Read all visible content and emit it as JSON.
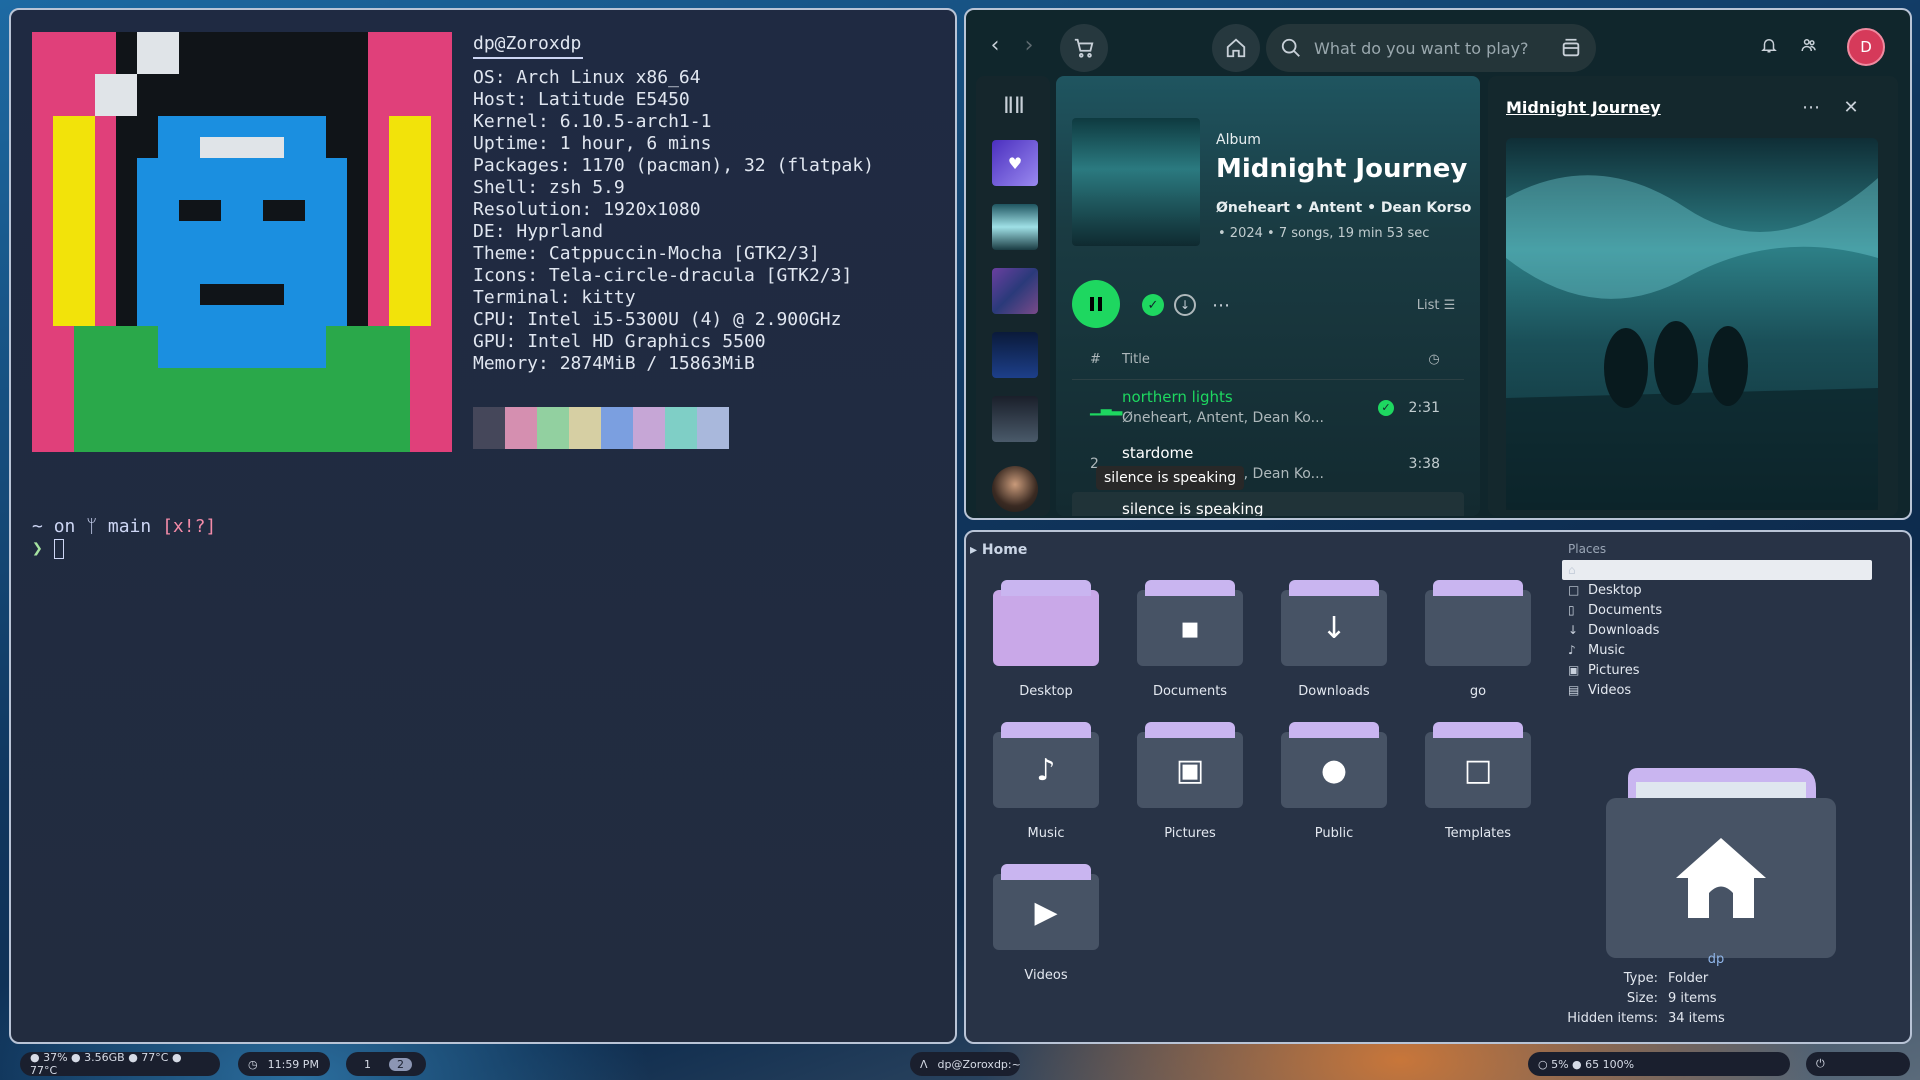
{
  "terminal": {
    "user_host": "dp@Zoroxdp",
    "info": [
      {
        "key": "OS",
        "value": "Arch Linux x86_64"
      },
      {
        "key": "Host",
        "value": "Latitude E5450"
      },
      {
        "key": "Kernel",
        "value": "6.10.5-arch1-1"
      },
      {
        "key": "Uptime",
        "value": "1 hour, 6 mins"
      },
      {
        "key": "Packages",
        "value": "1170 (pacman), 32 (flatpak)"
      },
      {
        "key": "Shell",
        "value": "zsh 5.9"
      },
      {
        "key": "Resolution",
        "value": "1920x1080"
      },
      {
        "key": "DE",
        "value": "Hyprland"
      },
      {
        "key": "Theme",
        "value": "Catppuccin-Mocha [GTK2/3]"
      },
      {
        "key": "Icons",
        "value": "Tela-circle-dracula [GTK2/3]"
      },
      {
        "key": "Terminal",
        "value": "kitty"
      },
      {
        "key": "CPU",
        "value": "Intel i5-5300U (4) @ 2.900GHz"
      },
      {
        "key": "GPU",
        "value": "Intel HD Graphics 5500"
      },
      {
        "key": "Memory",
        "value": "2874MiB / 15863MiB"
      }
    ],
    "swatch_colors": [
      "#45475a",
      "#d58fb0",
      "#92d0a0",
      "#d6cfa3",
      "#7b9fe0",
      "#c6a6d6",
      "#7fcfc6",
      "#a9b8dc"
    ],
    "prompt": {
      "dir": "~",
      "on": "on",
      "branch_icon": "ᛘ",
      "branch": "main",
      "flags": "[x!?]",
      "arrow": "❯"
    }
  },
  "spotify": {
    "search_placeholder": "What do you want to play?",
    "avatar_letter": "D",
    "album": {
      "type": "Album",
      "title": "Midnight Journey",
      "artists": "Øneheart • Antent • Dean Korso",
      "meta": "• 2024 • 7 songs, 19 min 53 sec"
    },
    "list_label": "List",
    "col_hash": "#",
    "col_title": "Title",
    "tracks": [
      {
        "num": "",
        "name": "northern lights",
        "artists": "Øneheart, Antent, Dean Ko...",
        "duration": "2:31",
        "playing": true
      },
      {
        "num": "2",
        "name": "stardome",
        "artists": "Øneheart, Antent, Dean Ko...",
        "duration": "3:38",
        "playing": false
      },
      {
        "num": "",
        "name": "silence is speaking",
        "artists": "",
        "duration": "",
        "playing": false
      }
    ],
    "tooltip": "silence is speaking",
    "now_playing_title": "Midnight Journey",
    "accent": "#1ed760"
  },
  "files": {
    "path": "Home",
    "folders": [
      {
        "label": "Desktop",
        "icon": "desktop-icon"
      },
      {
        "label": "Documents",
        "icon": "document-icon"
      },
      {
        "label": "Downloads",
        "icon": "download-icon"
      },
      {
        "label": "go",
        "icon": "folder-icon"
      },
      {
        "label": "Music",
        "icon": "music-note-icon"
      },
      {
        "label": "Pictures",
        "icon": "picture-icon"
      },
      {
        "label": "Public",
        "icon": "person-icon"
      },
      {
        "label": "Templates",
        "icon": "template-icon"
      },
      {
        "label": "Videos",
        "icon": "play-icon"
      }
    ],
    "places_header": "Places",
    "places": [
      "Home",
      "Desktop",
      "Documents",
      "Downloads",
      "Music",
      "Pictures",
      "Videos"
    ],
    "props": {
      "name": "dp",
      "type_k": "Type:",
      "type_v": "Folder",
      "size_k": "Size:",
      "size_v": "9 items",
      "hidden_k": "Hidden items:",
      "hidden_v": "34 items"
    }
  },
  "taskbar": {
    "stats": "● 37%  ● 3.56GB  ● 77°C  ● 77°C",
    "clock": "11:59 PM",
    "ws1": "1",
    "ws2": "2",
    "window_title": "dp@Zoroxdp:~",
    "right": "○ 5%   ● 65   100%"
  }
}
